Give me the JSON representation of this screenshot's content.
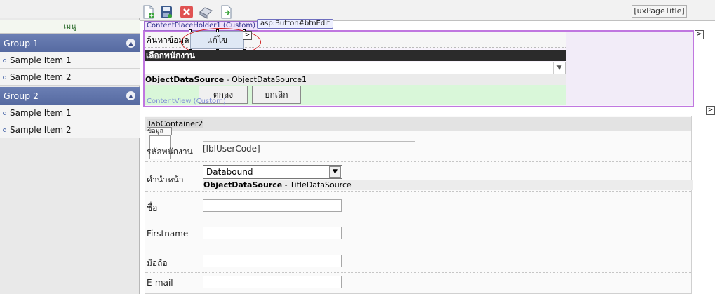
{
  "toolbar": {
    "icons": [
      "new-document-icon",
      "save-icon",
      "delete-icon",
      "print-icon",
      "export-icon"
    ],
    "page_title_placeholder": "[uxPageTitle]"
  },
  "sidebar": {
    "menu_title": "เมนู",
    "groups": [
      {
        "label": "Group 1",
        "items": [
          "Sample Item 1",
          "Sample Item 2"
        ]
      },
      {
        "label": "Group 2",
        "items": [
          "Sample Item 1",
          "Sample Item 2"
        ]
      }
    ]
  },
  "designer": {
    "content_placeholder_tab": "ContentPlaceHolder1 (Custom)",
    "selected_control_tag": "asp:Button#btnEdit",
    "search_label": "ค้นหาข้อมูล",
    "edit_button": "แก้ไข",
    "select_employee_header": "เลือกพนักงาน",
    "ods1_name": "ObjectDataSource",
    "ods1_id": " - ObjectDataSource1",
    "ok_button": "ตกลง",
    "cancel_button": "ยกเลิก",
    "content_view_label": "ContentView (Custom)",
    "smart_tag_glyph": ">"
  },
  "form": {
    "tab_container_label": "TabContainer2",
    "tab_header": "ข้อมูล",
    "user_code_label": "รหัสพนักงาน",
    "user_code_value": "[lblUserCode]",
    "title_label": "คำนำหน้า",
    "title_select_value": "Databound",
    "ods2_name": "ObjectDataSource",
    "ods2_id": " - TitleDataSource",
    "name_label": "ชื่อ",
    "firstname_label": "Firstname",
    "mobile_label": "มือถือ",
    "email_label": "E-mail"
  },
  "colors": {
    "group_header": "#566aa1",
    "placeholder_border": "#c077e0",
    "highlight_oval": "#d02020",
    "button_row": "#d9f7d9"
  }
}
